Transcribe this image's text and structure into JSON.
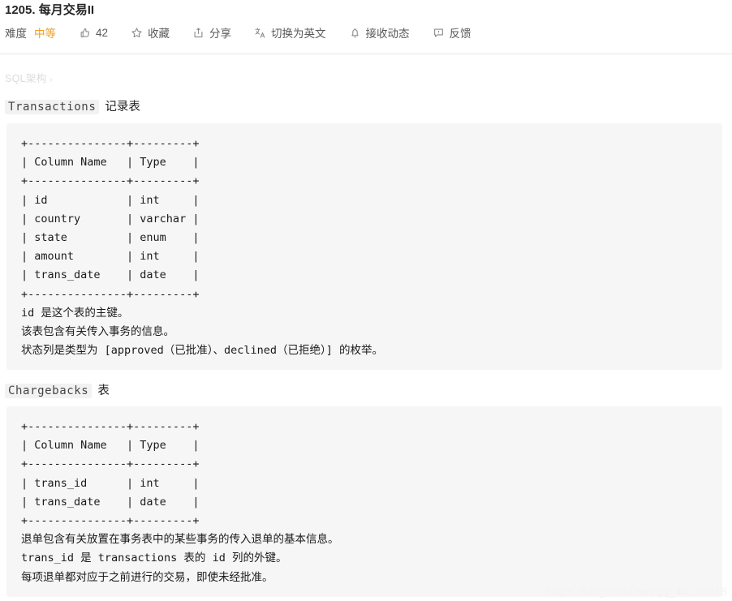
{
  "header": {
    "title": "1205. 每月交易II",
    "toolbar": [
      {
        "icon": "",
        "icon_name": "difficulty-label",
        "label": "难度",
        "value": "中等",
        "type": "difficulty"
      },
      {
        "icon": "thumbs-up-icon",
        "label": "42",
        "type": "action"
      },
      {
        "icon": "star-icon",
        "label": "收藏",
        "type": "action"
      },
      {
        "icon": "share-icon",
        "label": "分享",
        "type": "action"
      },
      {
        "icon": "translate-icon",
        "label": "切换为英文",
        "type": "action"
      },
      {
        "icon": "bell-icon",
        "label": "接收动态",
        "type": "action"
      },
      {
        "icon": "feedback-icon",
        "label": "反馈",
        "type": "action"
      }
    ]
  },
  "breadcrumb": {
    "label": "SQL架构",
    "chevron": "›"
  },
  "sections": [
    {
      "code_name": "Transactions",
      "suffix": "记录表",
      "table_ascii": "+---------------+---------+\n| Column Name   | Type    |\n+---------------+---------+\n| id            | int     |\n| country       | varchar |\n| state         | enum    |\n| amount        | int     |\n| trans_date    | date    |\n+---------------+---------+",
      "notes": "id 是这个表的主键。\n该表包含有关传入事务的信息。\n状态列是类型为 [approved（已批准）、declined（已拒绝）] 的枚举。"
    },
    {
      "code_name": "Chargebacks",
      "suffix": "表",
      "table_ascii": "+---------------+---------+\n| Column Name   | Type    |\n+---------------+---------+\n| trans_id      | int     |\n| trans_date    | date    |\n+---------------+---------+",
      "notes": "退单包含有关放置在事务表中的某些事务的传入退单的基本信息。\ntrans_id 是 transactions 表的 id 列的外键。\n每项退单都对应于之前进行的交易，即使未经批准。"
    }
  ],
  "watermark": {
    "text": "https://blog.csdn.net/qq_44186838"
  },
  "colors": {
    "difficulty_medium": "#f0a020",
    "code_background": "#f6f6f6",
    "divider": "#e8e8e8",
    "breadcrumb": "#dcdcdc"
  }
}
